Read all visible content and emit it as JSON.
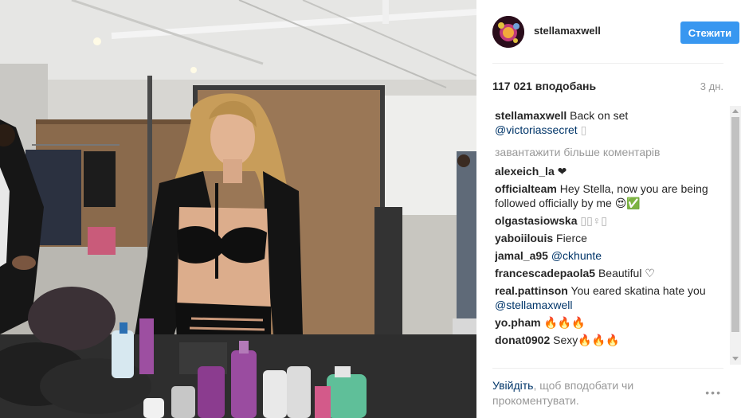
{
  "post": {
    "author": "stellamaxwell",
    "follow_label": "Стежити",
    "likes": "117 021 вподобань",
    "time": "3 дн.",
    "caption_user": "stellamaxwell",
    "caption_text": "Back on set",
    "caption_mention": "@victoriassecret",
    "caption_tail": " ▯",
    "load_more": "завантажити більше коментарів"
  },
  "comments": [
    {
      "user": "alexeich_la",
      "text": "❤"
    },
    {
      "user": "officialteam",
      "text": "Hey Stella, now you are being followed officially by me 😍✅"
    },
    {
      "user": "olgastasiowska",
      "text": "▯▯♀▯"
    },
    {
      "user": "yaboiilouis",
      "text": "Fierce"
    },
    {
      "user": "jamal_a95",
      "text": "",
      "mention": "@ckhunte"
    },
    {
      "user": "francescadepaola5",
      "text": "Beautiful ♡"
    },
    {
      "user": "real.pattinson",
      "text": "You eared skatina hate you ",
      "mention": "@stellamaxwell"
    },
    {
      "user": "yo.pham",
      "text": "🔥🔥🔥"
    },
    {
      "user": "donat0902",
      "text": "Sexy🔥🔥🔥"
    }
  ],
  "footer": {
    "login_link": "Увійдіть",
    "login_text": ", щоб вподобати чи прокоментувати.",
    "more": "•••"
  },
  "colors": {
    "accent": "#3897f0",
    "link": "#003569",
    "muted": "#999999"
  },
  "icons": [
    "avatar",
    "scroll-up-arrow",
    "scroll-down-arrow",
    "more-options-icon"
  ]
}
